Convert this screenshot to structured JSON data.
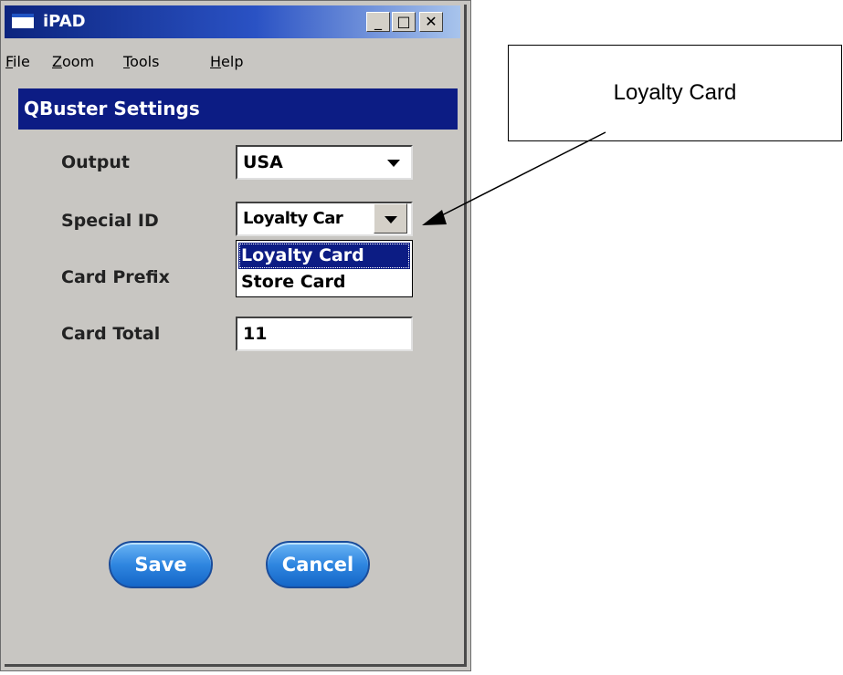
{
  "window": {
    "title": "iPAD",
    "controls": {
      "minimize": "_",
      "maximize": "□",
      "close": "✕"
    }
  },
  "menu": {
    "items": [
      {
        "label": "File",
        "underline": "F",
        "rest": "ile"
      },
      {
        "label": "Zoom",
        "underline": "Z",
        "rest": "oom"
      },
      {
        "label": "Tools",
        "underline": "T",
        "rest": "ools"
      },
      {
        "label": "Help",
        "underline": "H",
        "rest": "elp"
      }
    ]
  },
  "settings": {
    "header": "QBuster Settings",
    "output": {
      "label": "Output",
      "value": "USA"
    },
    "special_id": {
      "label": "Special ID",
      "value": "Loyalty Car",
      "options": [
        "Loyalty Card",
        "Store Card"
      ],
      "selected_option": "Loyalty Card"
    },
    "card_prefix": {
      "label": "Card Prefix"
    },
    "card_total": {
      "label": "Card Total",
      "value": "11"
    }
  },
  "buttons": {
    "save": "Save",
    "cancel": "Cancel"
  },
  "callout": {
    "text": "Loyalty Card"
  },
  "colors": {
    "titlebar_start": "#0c247e",
    "header_bg": "#0c1c84",
    "window_bg": "#c8c6c2",
    "button_blue": "#2f86e0"
  }
}
